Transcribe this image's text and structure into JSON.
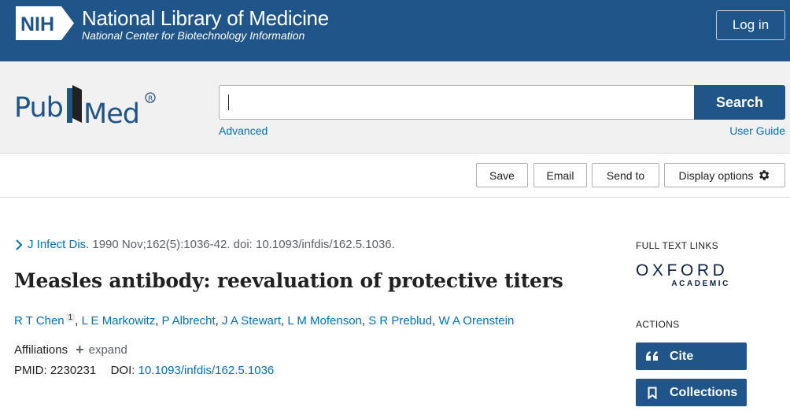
{
  "header": {
    "nih_mark": "NIH",
    "org_title": "National Library of Medicine",
    "org_subtitle": "National Center for Biotechnology Information",
    "login_label": "Log in",
    "bg_color": "#20558a"
  },
  "search": {
    "logo_text": "PubMed",
    "query_value": "",
    "button_label": "Search",
    "advanced_label": "Advanced",
    "guide_label": "User Guide"
  },
  "toolbar": {
    "save_label": "Save",
    "email_label": "Email",
    "send_label": "Send to",
    "display_label": "Display options",
    "display_icon": "gear-icon"
  },
  "article": {
    "journal": "J Infect Dis.",
    "citation": "1990 Nov;162(5):1036-42. doi: 10.1093/infdis/162.5.1036.",
    "title": "Measles antibody: reevaluation of protective titers",
    "authors": [
      {
        "name": "R T Chen",
        "sup": "1"
      },
      {
        "name": "L E Markowitz"
      },
      {
        "name": "P Albrecht"
      },
      {
        "name": "J A Stewart"
      },
      {
        "name": "L M Mofenson"
      },
      {
        "name": "S R Preblud"
      },
      {
        "name": "W A Orenstein"
      }
    ],
    "affiliations_label": "Affiliations",
    "expand_label": "expand",
    "pmid_label": "PMID:",
    "pmid_value": "2230231",
    "doi_label": "DOI:",
    "doi_value": "10.1093/infdis/162.5.1036"
  },
  "sidebar": {
    "full_text_heading": "FULL TEXT LINKS",
    "oxford_line1": "OXFORD",
    "oxford_line2": "ACADEMIC",
    "actions_heading": "ACTIONS",
    "cite_label": "Cite",
    "collections_label": "Collections"
  }
}
